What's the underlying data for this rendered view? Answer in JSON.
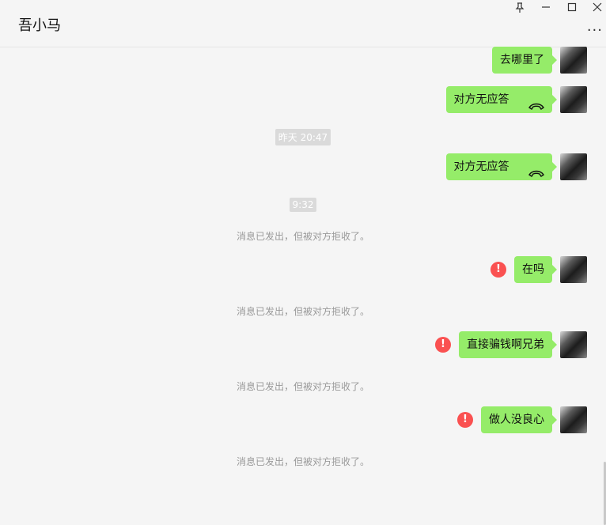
{
  "header": {
    "title": "吾小马",
    "pin_icon": "pin-icon",
    "minimize_icon": "minimize-icon",
    "maximize_icon": "maximize-icon",
    "close_icon": "close-icon",
    "more_label": "···"
  },
  "messages": {
    "m1": "去哪里了",
    "m2": "对方无应答",
    "t1": "昨天 20:47",
    "m3": "对方无应答",
    "t2": "9:32",
    "s1": "消息已发出，但被对方拒收了。",
    "m4": "在吗",
    "s2": "消息已发出，但被对方拒收了。",
    "m5": "直接骗钱啊兄弟",
    "s3": "消息已发出，但被对方拒收了。",
    "m6": "做人没良心",
    "s4": "消息已发出，但被对方拒收了。"
  },
  "warning_symbol": "!",
  "colors": {
    "bubble": "#95ec69",
    "warning": "#fa5151",
    "background": "#f5f5f5"
  }
}
